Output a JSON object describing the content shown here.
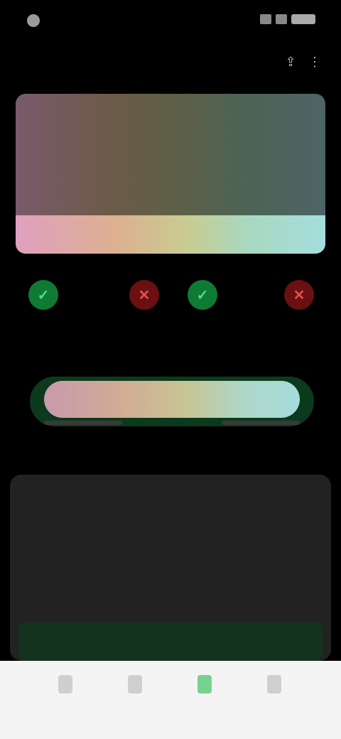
{
  "status_bar": {
    "time": ""
  },
  "header": {
    "title": ""
  },
  "hero": {
    "headline": ""
  },
  "filters": [
    {
      "kind": "positive",
      "glyph": "✓",
      "color": "#4fe07f"
    },
    {
      "kind": "negative",
      "glyph": "✕",
      "color": "#e05050"
    },
    {
      "kind": "positive",
      "glyph": "✓",
      "color": "#4fe07f"
    },
    {
      "kind": "negative",
      "glyph": "✕",
      "color": "#e05050"
    }
  ],
  "row": {
    "left_label": "",
    "right_label": "",
    "caption": ""
  },
  "panel": {
    "title": "",
    "description": "",
    "subheading": ""
  },
  "bottom_nav": [
    {
      "label": "",
      "icon": "home-icon"
    },
    {
      "label": "",
      "icon": "list-icon"
    },
    {
      "label": "",
      "icon": "leaf-icon",
      "active": true
    },
    {
      "label": "",
      "icon": "profile-icon"
    }
  ],
  "colors": {
    "background": "#000000",
    "panel": "#222222",
    "accent_green": "#4fe07f",
    "accent_red": "#e05050",
    "nav_background": "#f4f4f4"
  }
}
